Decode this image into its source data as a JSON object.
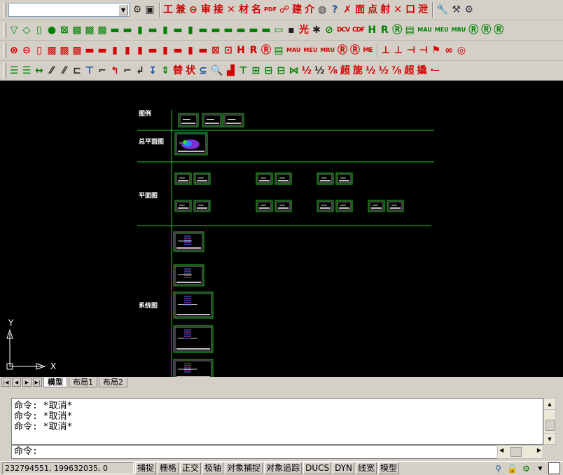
{
  "toolbar1": {
    "layer_combo_value": "",
    "icons": [
      {
        "name": "layer-settings-icon",
        "glyph": "⚙",
        "color": "#333"
      },
      {
        "name": "layer-manager-icon",
        "glyph": "▣",
        "color": "#222"
      },
      {
        "name": "sep"
      },
      {
        "name": "cmd-gong",
        "glyph": "工",
        "color": "#d40000"
      },
      {
        "name": "cmd-jian",
        "glyph": "兼",
        "color": "#d40000"
      },
      {
        "name": "cmd-circle-minus",
        "glyph": "⊖",
        "color": "#d40000"
      },
      {
        "name": "cmd-shen",
        "glyph": "审",
        "color": "#d40000"
      },
      {
        "name": "cmd-jie",
        "glyph": "接",
        "color": "#d40000"
      },
      {
        "name": "cmd-cross-out",
        "glyph": "✕",
        "color": "#d40000"
      },
      {
        "name": "cmd-cai",
        "glyph": "材",
        "color": "#d40000"
      },
      {
        "name": "cmd-ming",
        "glyph": "名",
        "color": "#d40000"
      },
      {
        "name": "pdf-icon",
        "glyph": "PDF",
        "color": "#d40000",
        "cls": "xs"
      },
      {
        "name": "cmd-link",
        "glyph": "☍",
        "color": "#d40000"
      },
      {
        "name": "cmd-jianjie",
        "glyph": "建",
        "color": "#d40000"
      },
      {
        "name": "cmd-jie2",
        "glyph": "介",
        "color": "#d40000"
      },
      {
        "name": "cmd-compass",
        "glyph": "◍",
        "color": "#333"
      },
      {
        "name": "help-icon",
        "glyph": "?",
        "color": "#1a4fa0"
      },
      {
        "name": "cmd-crossx",
        "glyph": "✗",
        "color": "#d40000"
      },
      {
        "name": "cmd-mian",
        "glyph": "面",
        "color": "#d40000"
      },
      {
        "name": "cmd-dian",
        "glyph": "点",
        "color": "#d40000"
      },
      {
        "name": "cmd-she",
        "glyph": "射",
        "color": "#d40000"
      },
      {
        "name": "cmd-cross2",
        "glyph": "✕",
        "color": "#d40000"
      },
      {
        "name": "cmd-kou",
        "glyph": "口",
        "color": "#d40000"
      },
      {
        "name": "cmd-xie",
        "glyph": "泄",
        "color": "#d40000"
      },
      {
        "name": "sep"
      },
      {
        "name": "wrench-icon",
        "glyph": "🔧",
        "color": "#334"
      },
      {
        "name": "tool-icon",
        "glyph": "⚒",
        "color": "#334"
      },
      {
        "name": "tool2-icon",
        "glyph": "⚙",
        "color": "#334"
      }
    ]
  },
  "toolbar2": {
    "icons": [
      {
        "name": "filter-icon",
        "glyph": "▽",
        "color": "#008000"
      },
      {
        "name": "valve-diamond-icon",
        "glyph": "◇",
        "color": "#008000"
      },
      {
        "name": "pipe-icon",
        "glyph": "▯",
        "color": "#008000"
      },
      {
        "name": "circle-fill-icon",
        "glyph": "●",
        "color": "#008000"
      },
      {
        "name": "valve-x-icon",
        "glyph": "⊠",
        "color": "#008000"
      },
      {
        "name": "valve-b-icon",
        "glyph": "▩",
        "color": "#008000"
      },
      {
        "name": "valve-c-icon",
        "glyph": "▩",
        "color": "#008000"
      },
      {
        "name": "valve-d-icon",
        "glyph": "▩",
        "color": "#008000"
      },
      {
        "name": "coupler-icon",
        "glyph": "▬",
        "color": "#008000"
      },
      {
        "name": "coupler2-icon",
        "glyph": "▬",
        "color": "#008000"
      },
      {
        "name": "coupler3-icon",
        "glyph": "▮",
        "color": "#008000"
      },
      {
        "name": "coupler4-icon",
        "glyph": "▬",
        "color": "#008000"
      },
      {
        "name": "coupler5-icon",
        "glyph": "▮",
        "color": "#008000"
      },
      {
        "name": "coupler6-icon",
        "glyph": "▬",
        "color": "#008000"
      },
      {
        "name": "coupler7-icon",
        "glyph": "▮",
        "color": "#008000"
      },
      {
        "name": "coupler8-icon",
        "glyph": "▬",
        "color": "#008000"
      },
      {
        "name": "coupler9-icon",
        "glyph": "▬",
        "color": "#008000"
      },
      {
        "name": "coupler10-icon",
        "glyph": "▬",
        "color": "#008000"
      },
      {
        "name": "coupler11-icon",
        "glyph": "▬",
        "color": "#008000"
      },
      {
        "name": "coupler12-icon",
        "glyph": "▬",
        "color": "#008000"
      },
      {
        "name": "coupler13-icon",
        "glyph": "▬",
        "color": "#008000"
      },
      {
        "name": "union-icon",
        "glyph": "▭",
        "color": "#008000"
      },
      {
        "name": "end-cap-icon",
        "glyph": "▪",
        "color": "#222"
      },
      {
        "name": "light-icon",
        "glyph": "光",
        "color": "#d40000"
      },
      {
        "name": "spark-icon",
        "glyph": "✱",
        "color": "#222"
      },
      {
        "name": "theta-icon",
        "glyph": "⊘",
        "color": "#008000"
      },
      {
        "name": "dcv-icon",
        "glyph": "DCV",
        "color": "#d40000",
        "cls": "sm"
      },
      {
        "name": "cdf-icon",
        "glyph": "CDF",
        "color": "#d40000",
        "cls": "sm"
      },
      {
        "name": "h-icon",
        "glyph": "H",
        "color": "#008000"
      },
      {
        "name": "r-icon",
        "glyph": "R",
        "color": "#008000"
      },
      {
        "name": "r-box-icon",
        "glyph": "Ⓡ",
        "color": "#008000"
      },
      {
        "name": "grid-icon",
        "glyph": "▤",
        "color": "#008000"
      },
      {
        "name": "mau-icon",
        "glyph": "MAU",
        "color": "#008000",
        "cls": "xs"
      },
      {
        "name": "meu-icon",
        "glyph": "MEU",
        "color": "#008000",
        "cls": "xs"
      },
      {
        "name": "mru-icon",
        "glyph": "MRU",
        "color": "#008000",
        "cls": "xs"
      },
      {
        "name": "r-circle-icon",
        "glyph": "Ⓡ",
        "color": "#008000"
      },
      {
        "name": "r-circle2-icon",
        "glyph": "Ⓡ",
        "color": "#008000"
      },
      {
        "name": "r-circle3-icon",
        "glyph": "Ⓡ",
        "color": "#008000"
      }
    ]
  },
  "toolbar3": {
    "icons": [
      {
        "name": "cross-circle-icon",
        "glyph": "⊗",
        "color": "#d40000"
      },
      {
        "name": "minus-circle-icon",
        "glyph": "⊖",
        "color": "#d40000"
      },
      {
        "name": "pipe-red-icon",
        "glyph": "▯",
        "color": "#d40000"
      },
      {
        "name": "valve-red-icon",
        "glyph": "▩",
        "color": "#d40000"
      },
      {
        "name": "valve-red2-icon",
        "glyph": "▩",
        "color": "#d40000"
      },
      {
        "name": "valve-red3-icon",
        "glyph": "▩",
        "color": "#d40000"
      },
      {
        "name": "coupler-red-icon",
        "glyph": "▬",
        "color": "#d40000"
      },
      {
        "name": "coupler-red2-icon",
        "glyph": "▬",
        "color": "#d40000"
      },
      {
        "name": "coupler-red3-icon",
        "glyph": "▮",
        "color": "#d40000"
      },
      {
        "name": "coupler-red4-icon",
        "glyph": "▮",
        "color": "#d40000"
      },
      {
        "name": "coupler-red5-icon",
        "glyph": "▮",
        "color": "#d40000"
      },
      {
        "name": "coupler-red6-icon",
        "glyph": "▬",
        "color": "#d40000"
      },
      {
        "name": "coupler-red7-icon",
        "glyph": "▮",
        "color": "#d40000"
      },
      {
        "name": "coupler-red8-icon",
        "glyph": "▬",
        "color": "#d40000"
      },
      {
        "name": "coupler-red9-icon",
        "glyph": "▮",
        "color": "#d40000"
      },
      {
        "name": "coupler-red10-icon",
        "glyph": "▬",
        "color": "#d40000"
      },
      {
        "name": "box-x-icon",
        "glyph": "⊠",
        "color": "#d40000"
      },
      {
        "name": "box-grid-icon",
        "glyph": "⊡",
        "color": "#d40000"
      },
      {
        "name": "h-red-icon",
        "glyph": "H",
        "color": "#d40000"
      },
      {
        "name": "r-red-icon",
        "glyph": "R",
        "color": "#d40000"
      },
      {
        "name": "r-box-red-icon",
        "glyph": "Ⓡ",
        "color": "#d40000"
      },
      {
        "name": "grid-green-icon",
        "glyph": "▤",
        "color": "#008000"
      },
      {
        "name": "mau-red-icon",
        "glyph": "MAU",
        "color": "#d40000",
        "cls": "xs"
      },
      {
        "name": "meu-red-icon",
        "glyph": "MEU",
        "color": "#d40000",
        "cls": "xs"
      },
      {
        "name": "mru-red-icon",
        "glyph": "MRU",
        "color": "#d40000",
        "cls": "xs"
      },
      {
        "name": "r-circle-red-icon",
        "glyph": "Ⓡ",
        "color": "#d40000"
      },
      {
        "name": "r-circle-red2-icon",
        "glyph": "Ⓡ",
        "color": "#d40000"
      },
      {
        "name": "me-icon",
        "glyph": "ME",
        "color": "#d40000",
        "cls": "sm"
      },
      {
        "name": "sep"
      },
      {
        "name": "rail-icon",
        "glyph": "⊥",
        "color": "#d40000"
      },
      {
        "name": "rail2-icon",
        "glyph": "⊥",
        "color": "#d40000"
      },
      {
        "name": "branch-icon",
        "glyph": "⊣",
        "color": "#d40000"
      },
      {
        "name": "branch2-icon",
        "glyph": "⊣",
        "color": "#d40000"
      },
      {
        "name": "flag-icon",
        "glyph": "⚑",
        "color": "#d40000"
      },
      {
        "name": "link-icon",
        "glyph": "∞",
        "color": "#d40000"
      },
      {
        "name": "target-icon",
        "glyph": "◎",
        "color": "#d40000"
      }
    ]
  },
  "toolbar4": {
    "icons": [
      {
        "name": "align-icon",
        "glyph": "☰",
        "color": "#008000"
      },
      {
        "name": "align2-icon",
        "glyph": "☰",
        "color": "#008000"
      },
      {
        "name": "width-icon",
        "glyph": "↔",
        "color": "#008000"
      },
      {
        "name": "slash-icon",
        "glyph": "⁄⁄",
        "color": "#222"
      },
      {
        "name": "slash2-icon",
        "glyph": "⁄⁄",
        "color": "#222"
      },
      {
        "name": "bracket-icon",
        "glyph": "⊏",
        "color": "#222"
      },
      {
        "name": "level-icon",
        "glyph": "⊤",
        "color": "#1a4fa0"
      },
      {
        "name": "stair-icon",
        "glyph": "⌐",
        "color": "#222"
      },
      {
        "name": "bend-icon",
        "glyph": "↰",
        "color": "#d40000"
      },
      {
        "name": "elbow-icon",
        "glyph": "⌐",
        "color": "#222"
      },
      {
        "name": "elbow2-icon",
        "glyph": "↲",
        "color": "#222"
      },
      {
        "name": "tee-icon",
        "glyph": "↧",
        "color": "#1a4fa0"
      },
      {
        "name": "ladder-icon",
        "glyph": "⇕",
        "color": "#008000"
      },
      {
        "name": "mao-icon",
        "glyph": "替",
        "color": "#d40000"
      },
      {
        "name": "zhuang-icon",
        "glyph": "状",
        "color": "#d40000"
      },
      {
        "name": "step-icon",
        "glyph": "⊊",
        "color": "#1a4fa0"
      },
      {
        "name": "zoom-icon",
        "glyph": "🔍",
        "color": "#222"
      },
      {
        "name": "paint-icon",
        "glyph": "▟",
        "color": "#d40000"
      },
      {
        "name": "tee-green-icon",
        "glyph": "⊤",
        "color": "#008000"
      },
      {
        "name": "frame-icon",
        "glyph": "⊞",
        "color": "#008000"
      },
      {
        "name": "frame2-icon",
        "glyph": "⊟",
        "color": "#008000"
      },
      {
        "name": "frame3-icon",
        "glyph": "⊟",
        "color": "#008000"
      },
      {
        "name": "weave-icon",
        "glyph": "⋈",
        "color": "#008000"
      },
      {
        "name": "half-icon",
        "glyph": "½",
        "color": "#d40000"
      },
      {
        "name": "half2-icon",
        "glyph": "½",
        "color": "#222"
      },
      {
        "name": "v3-icon",
        "glyph": "⅞",
        "color": "#d40000"
      },
      {
        "name": "chao-icon",
        "glyph": "超",
        "color": "#d40000"
      },
      {
        "name": "ni-icon",
        "glyph": "旎",
        "color": "#d40000"
      },
      {
        "name": "half3-icon",
        "glyph": "½",
        "color": "#d40000"
      },
      {
        "name": "half4-icon",
        "glyph": "½",
        "color": "#d40000"
      },
      {
        "name": "v3b-icon",
        "glyph": "⅞",
        "color": "#d40000"
      },
      {
        "name": "chao2-icon",
        "glyph": "超",
        "color": "#d40000"
      },
      {
        "name": "jiao-icon",
        "glyph": "撬",
        "color": "#d40000"
      },
      {
        "name": "dot-line-icon",
        "glyph": "•—",
        "color": "#d40000",
        "cls": "sm"
      }
    ]
  },
  "drawing": {
    "sections": [
      {
        "label": "图例"
      },
      {
        "label": "总平面图"
      },
      {
        "label": "平面图"
      },
      {
        "label": "系统图"
      }
    ],
    "line_color": "#22c922",
    "ucs": {
      "y": "Y",
      "x": "X"
    }
  },
  "layout_tabs": {
    "nav": [
      "|◀",
      "◀",
      "▶",
      "▶|"
    ],
    "tabs": [
      {
        "label": "模型",
        "active": true
      },
      {
        "label": "布局1",
        "active": false
      },
      {
        "label": "布局2",
        "active": false
      }
    ]
  },
  "command": {
    "history": [
      "命令: *取消*",
      "命令: *取消*",
      "命令: *取消*"
    ],
    "prompt": "命令:"
  },
  "status": {
    "coordinates": "232794551, 199632035, 0",
    "toggles": [
      "捕捉",
      "栅格",
      "正交",
      "极轴",
      "对象捕捉",
      "对象追踪",
      "DUCS",
      "DYN",
      "线宽",
      "模型"
    ]
  }
}
